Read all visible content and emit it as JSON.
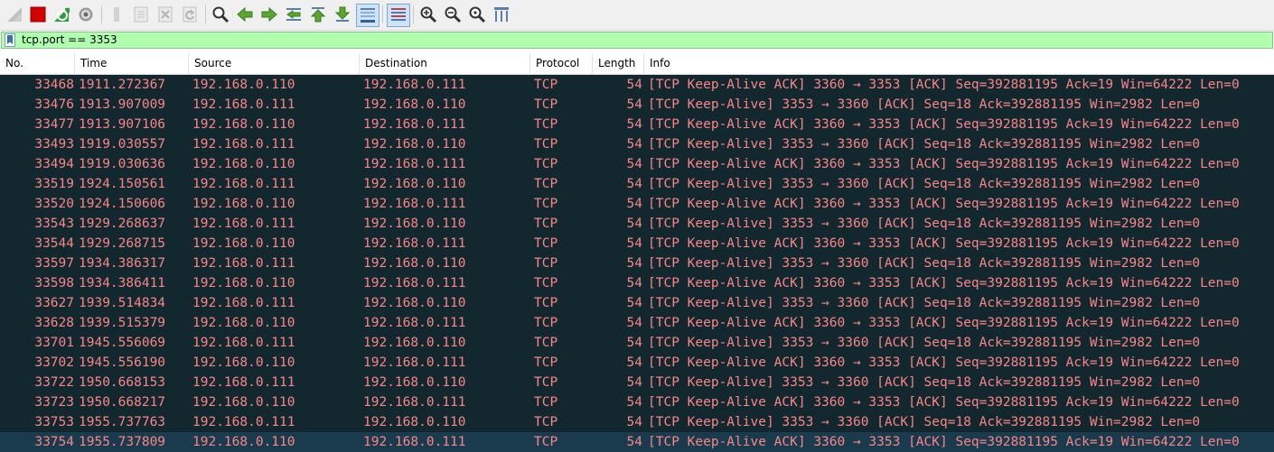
{
  "toolbar": {
    "buttons": [
      {
        "name": "start-capture-icon",
        "state": "disabled"
      },
      {
        "name": "stop-capture-icon",
        "state": "enabled"
      },
      {
        "name": "restart-capture-icon",
        "state": "enabled"
      },
      {
        "name": "capture-options-icon",
        "state": "enabled"
      },
      {
        "name": "open-file-icon",
        "state": "disabled"
      },
      {
        "name": "save-file-icon",
        "state": "disabled"
      },
      {
        "name": "close-file-icon",
        "state": "disabled"
      },
      {
        "name": "reload-file-icon",
        "state": "disabled"
      },
      {
        "name": "find-packet-icon",
        "state": "enabled"
      },
      {
        "name": "go-back-icon",
        "state": "enabled"
      },
      {
        "name": "go-forward-icon",
        "state": "enabled"
      },
      {
        "name": "go-to-packet-icon",
        "state": "enabled"
      },
      {
        "name": "first-packet-icon",
        "state": "enabled"
      },
      {
        "name": "last-packet-icon",
        "state": "enabled"
      },
      {
        "name": "auto-scroll-icon",
        "state": "pressed"
      },
      {
        "name": "colorize-icon",
        "state": "pressed"
      },
      {
        "name": "zoom-in-icon",
        "state": "enabled"
      },
      {
        "name": "zoom-out-icon",
        "state": "enabled"
      },
      {
        "name": "normal-size-icon",
        "state": "enabled"
      },
      {
        "name": "resize-columns-icon",
        "state": "enabled"
      }
    ]
  },
  "filter": {
    "value": "tcp.port == 3353",
    "background": "#afffaf"
  },
  "columns": [
    "No.",
    "Time",
    "Source",
    "Destination",
    "Protocol",
    "Length",
    "Info"
  ],
  "colors": {
    "row_background": "#12272e",
    "row_text": "#f78787",
    "selected_row_background": "#1a3a4d"
  },
  "packets": [
    {
      "no": "33468",
      "time": "1911.272367",
      "src": "192.168.0.110",
      "dst": "192.168.0.111",
      "proto": "TCP",
      "len": "54",
      "info": "[TCP Keep-Alive ACK] 3360 → 3353 [ACK] Seq=392881195 Ack=19 Win=64222 Len=0"
    },
    {
      "no": "33476",
      "time": "1913.907009",
      "src": "192.168.0.111",
      "dst": "192.168.0.110",
      "proto": "TCP",
      "len": "54",
      "info": "[TCP Keep-Alive] 3353 → 3360 [ACK] Seq=18 Ack=392881195 Win=2982 Len=0"
    },
    {
      "no": "33477",
      "time": "1913.907106",
      "src": "192.168.0.110",
      "dst": "192.168.0.111",
      "proto": "TCP",
      "len": "54",
      "info": "[TCP Keep-Alive ACK] 3360 → 3353 [ACK] Seq=392881195 Ack=19 Win=64222 Len=0"
    },
    {
      "no": "33493",
      "time": "1919.030557",
      "src": "192.168.0.111",
      "dst": "192.168.0.110",
      "proto": "TCP",
      "len": "54",
      "info": "[TCP Keep-Alive] 3353 → 3360 [ACK] Seq=18 Ack=392881195 Win=2982 Len=0"
    },
    {
      "no": "33494",
      "time": "1919.030636",
      "src": "192.168.0.110",
      "dst": "192.168.0.111",
      "proto": "TCP",
      "len": "54",
      "info": "[TCP Keep-Alive ACK] 3360 → 3353 [ACK] Seq=392881195 Ack=19 Win=64222 Len=0"
    },
    {
      "no": "33519",
      "time": "1924.150561",
      "src": "192.168.0.111",
      "dst": "192.168.0.110",
      "proto": "TCP",
      "len": "54",
      "info": "[TCP Keep-Alive] 3353 → 3360 [ACK] Seq=18 Ack=392881195 Win=2982 Len=0"
    },
    {
      "no": "33520",
      "time": "1924.150606",
      "src": "192.168.0.110",
      "dst": "192.168.0.111",
      "proto": "TCP",
      "len": "54",
      "info": "[TCP Keep-Alive ACK] 3360 → 3353 [ACK] Seq=392881195 Ack=19 Win=64222 Len=0"
    },
    {
      "no": "33543",
      "time": "1929.268637",
      "src": "192.168.0.111",
      "dst": "192.168.0.110",
      "proto": "TCP",
      "len": "54",
      "info": "[TCP Keep-Alive] 3353 → 3360 [ACK] Seq=18 Ack=392881195 Win=2982 Len=0"
    },
    {
      "no": "33544",
      "time": "1929.268715",
      "src": "192.168.0.110",
      "dst": "192.168.0.111",
      "proto": "TCP",
      "len": "54",
      "info": "[TCP Keep-Alive ACK] 3360 → 3353 [ACK] Seq=392881195 Ack=19 Win=64222 Len=0"
    },
    {
      "no": "33597",
      "time": "1934.386317",
      "src": "192.168.0.111",
      "dst": "192.168.0.110",
      "proto": "TCP",
      "len": "54",
      "info": "[TCP Keep-Alive] 3353 → 3360 [ACK] Seq=18 Ack=392881195 Win=2982 Len=0"
    },
    {
      "no": "33598",
      "time": "1934.386411",
      "src": "192.168.0.110",
      "dst": "192.168.0.111",
      "proto": "TCP",
      "len": "54",
      "info": "[TCP Keep-Alive ACK] 3360 → 3353 [ACK] Seq=392881195 Ack=19 Win=64222 Len=0"
    },
    {
      "no": "33627",
      "time": "1939.514834",
      "src": "192.168.0.111",
      "dst": "192.168.0.110",
      "proto": "TCP",
      "len": "54",
      "info": "[TCP Keep-Alive] 3353 → 3360 [ACK] Seq=18 Ack=392881195 Win=2982 Len=0"
    },
    {
      "no": "33628",
      "time": "1939.515379",
      "src": "192.168.0.110",
      "dst": "192.168.0.111",
      "proto": "TCP",
      "len": "54",
      "info": "[TCP Keep-Alive ACK] 3360 → 3353 [ACK] Seq=392881195 Ack=19 Win=64222 Len=0"
    },
    {
      "no": "33701",
      "time": "1945.556069",
      "src": "192.168.0.111",
      "dst": "192.168.0.110",
      "proto": "TCP",
      "len": "54",
      "info": "[TCP Keep-Alive] 3353 → 3360 [ACK] Seq=18 Ack=392881195 Win=2982 Len=0"
    },
    {
      "no": "33702",
      "time": "1945.556190",
      "src": "192.168.0.110",
      "dst": "192.168.0.111",
      "proto": "TCP",
      "len": "54",
      "info": "[TCP Keep-Alive ACK] 3360 → 3353 [ACK] Seq=392881195 Ack=19 Win=64222 Len=0"
    },
    {
      "no": "33722",
      "time": "1950.668153",
      "src": "192.168.0.111",
      "dst": "192.168.0.110",
      "proto": "TCP",
      "len": "54",
      "info": "[TCP Keep-Alive] 3353 → 3360 [ACK] Seq=18 Ack=392881195 Win=2982 Len=0"
    },
    {
      "no": "33723",
      "time": "1950.668217",
      "src": "192.168.0.110",
      "dst": "192.168.0.111",
      "proto": "TCP",
      "len": "54",
      "info": "[TCP Keep-Alive ACK] 3360 → 3353 [ACK] Seq=392881195 Ack=19 Win=64222 Len=0"
    },
    {
      "no": "33753",
      "time": "1955.737763",
      "src": "192.168.0.111",
      "dst": "192.168.0.110",
      "proto": "TCP",
      "len": "54",
      "info": "[TCP Keep-Alive] 3353 → 3360 [ACK] Seq=18 Ack=392881195 Win=2982 Len=0"
    },
    {
      "no": "33754",
      "time": "1955.737809",
      "src": "192.168.0.110",
      "dst": "192.168.0.111",
      "proto": "TCP",
      "len": "54",
      "info": "[TCP Keep-Alive ACK] 3360 → 3353 [ACK] Seq=392881195 Ack=19 Win=64222 Len=0",
      "selected": true
    }
  ]
}
